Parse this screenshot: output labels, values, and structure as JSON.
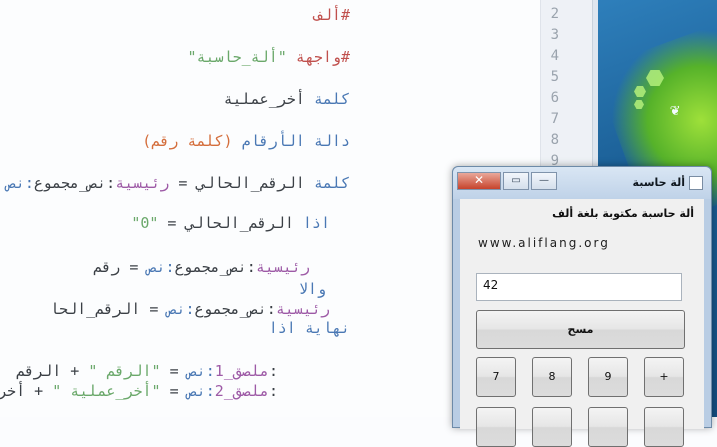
{
  "editor": {
    "line_numbers": [
      "2",
      "3",
      "4",
      "5",
      "6",
      "7",
      "8",
      "9"
    ],
    "lines": {
      "l2": {
        "t1": "#ألف"
      },
      "l4": {
        "t1": "#واجهة ",
        "t2": "\"ألة_حاسبة\""
      },
      "l6": {
        "t1": "كلمة ",
        "t2": "أخر_عملية"
      },
      "l8": {
        "t1": "دالة الأرقام ",
        "t2": "(كلمة رقم)"
      },
      "l9": {
        "t1": "كلمة ",
        "t2": "الرقم_الحالي = ",
        "t3": "رئيسية",
        "t4": ":نص_مجموع",
        "t5": ":نص"
      },
      "l10": {
        "t1": "اذا ",
        "t2": "الرقم_الحالي = ",
        "t3": "\"0\""
      },
      "l11": {
        "t1": "رئيسية",
        "t2": ":نص_مجموع",
        "t3": ":نص",
        "t4": " = رقم"
      },
      "l12": {
        "t1": "والا"
      },
      "l13": {
        "t1": "رئيسية",
        "t2": ":نص_مجموع",
        "t3": ":نص",
        "t4": " = الرقم_الحا"
      },
      "l14": {
        "t1": "نهاية اذا"
      },
      "l15": {
        "t1": ":",
        "t2": "ملصق_1",
        "t3": ":نص",
        "t4": " = ",
        "t5": "\"الرقم \"",
        "t6": " + الرقم"
      },
      "l16": {
        "t1": ":",
        "t2": "ملصق_2",
        "t3": ":نص",
        "t4": " = ",
        "t5": "\"أخر_عملية \"",
        "t6": " + أخر_عملية"
      }
    }
  },
  "calculator": {
    "window_title": "ألة حاسبة",
    "close_label": "✕",
    "maximize_label": "▭",
    "minimize_label": "—",
    "heading": "ألة حاسبة مكتوبة بلغة ألف",
    "url": "www.aliflang.org",
    "display_value": "42",
    "clear_label": "مسح",
    "keys": [
      "7",
      "8",
      "9",
      "+"
    ]
  },
  "colors": {
    "keyword": "#4a78b4",
    "string": "#6aa86a",
    "comment_red": "#c0504d",
    "identifier_purple": "#9d5aa6"
  }
}
